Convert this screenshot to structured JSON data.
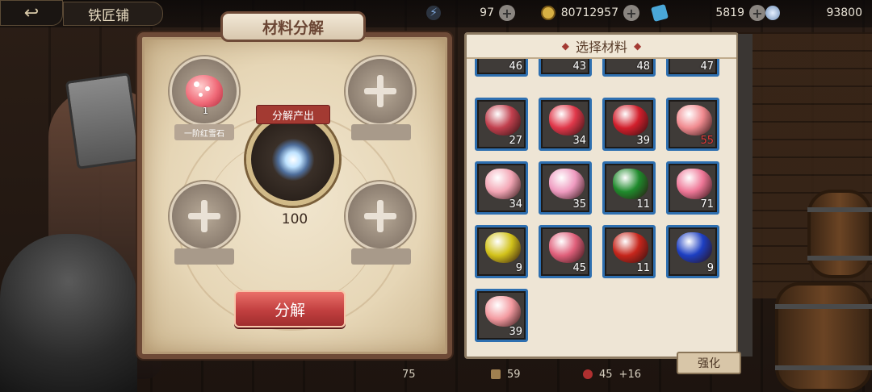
{
  "topbar": {
    "back_icon": "back-arrow-icon",
    "shop_title": "铁匠铺",
    "resources": [
      {
        "icon": "lightning-icon",
        "value": "97",
        "color": "#7fa6d8"
      },
      {
        "icon": "gold-coin-icon",
        "value": "80712957",
        "color": "#d7b044"
      },
      {
        "icon": "blue-gem-icon",
        "value": "5819",
        "color": "#4aa7d8"
      },
      {
        "icon": "crystal-flower-icon",
        "value": "93800",
        "color": "#a9c6e8"
      }
    ]
  },
  "decompose_panel": {
    "title": "材料分解",
    "slot1_count": "1",
    "slot1_label": "一阶红雪石",
    "output_banner": "分解产出",
    "output_value": "100",
    "decompose_button": "分解"
  },
  "material_panel": {
    "title": "选择材料",
    "top_row_counts": [
      "46",
      "43",
      "48",
      "47"
    ],
    "materials": [
      {
        "count": "27",
        "gem": "striped-red-gem",
        "color": "#c1404e"
      },
      {
        "count": "34",
        "gem": "red-ruby-gem",
        "color": "#e0384a"
      },
      {
        "count": "39",
        "gem": "square-ruby-gem",
        "color": "#d21f2c"
      },
      {
        "count": "55",
        "gem": "red-snow-stone",
        "color": "#f08a8f",
        "low": true
      },
      {
        "count": "34",
        "gem": "pink-cluster-gem",
        "color": "#f3a6b5"
      },
      {
        "count": "35",
        "gem": "pink-crystal-gem",
        "color": "#ef9bc0"
      },
      {
        "count": "11",
        "gem": "emerald-gem",
        "color": "#1f8a2c"
      },
      {
        "count": "71",
        "gem": "pink-shard-gem",
        "color": "#ee7797"
      },
      {
        "count": "9",
        "gem": "topaz-gem",
        "color": "#d2c21a"
      },
      {
        "count": "45",
        "gem": "pink-diamond-gem",
        "color": "#e0607b"
      },
      {
        "count": "11",
        "gem": "garnet-gem",
        "color": "#c6261c"
      },
      {
        "count": "9",
        "gem": "sapphire-gem",
        "color": "#1d3fc2"
      },
      {
        "count": "39",
        "gem": "rose-quartz-gem",
        "color": "#f39aa0"
      }
    ]
  },
  "background_ui": {
    "strengthen_button": "强化",
    "level": "75",
    "stat1": "59",
    "stat2": "45",
    "stat2_bonus": "+16"
  }
}
